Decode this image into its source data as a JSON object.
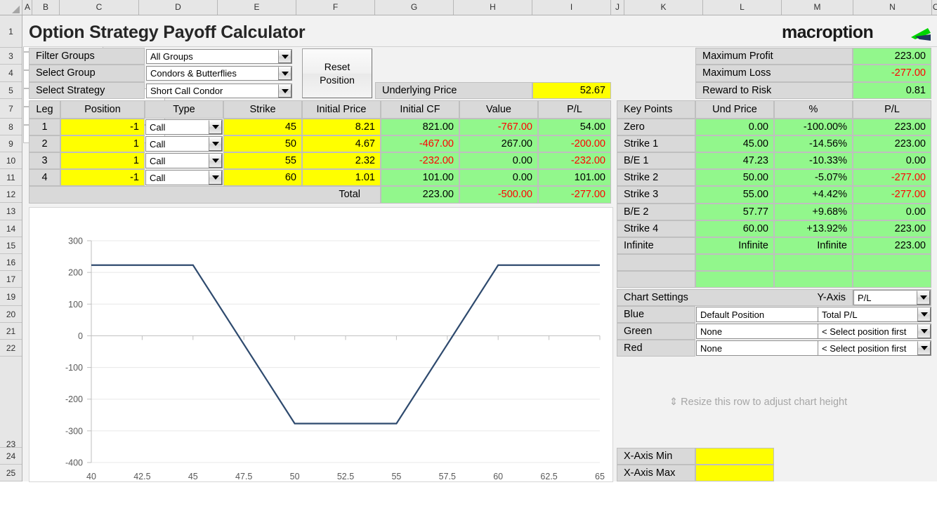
{
  "app": {
    "title": "Option Strategy Payoff Calculator",
    "logo": "macroption"
  },
  "columns": [
    "A",
    "B",
    "C",
    "D",
    "E",
    "F",
    "G",
    "H",
    "I",
    "J",
    "K",
    "L",
    "M",
    "N",
    "O"
  ],
  "rows": [
    "1",
    "3",
    "4",
    "5",
    "7",
    "8",
    "9",
    "10",
    "11",
    "12",
    "13",
    "14",
    "15",
    "16",
    "17",
    "19",
    "20",
    "21",
    "22",
    "23",
    "24",
    "25"
  ],
  "selectors": {
    "filter_groups_label": "Filter Groups",
    "filter_groups_value": "All Groups",
    "select_group_label": "Select Group",
    "select_group_value": "Condors & Butterflies",
    "select_strategy_label": "Select Strategy",
    "select_strategy_value": "Short Call Condor",
    "reset_button": "Reset Position"
  },
  "underlying": {
    "label": "Underlying Price",
    "value": "52.67"
  },
  "summary": {
    "rows": [
      {
        "label": "Maximum Profit",
        "value": "223.00",
        "negative": false
      },
      {
        "label": "Maximum Loss",
        "value": "-277.00",
        "negative": true
      },
      {
        "label": "Reward to Risk",
        "value": "0.81",
        "negative": false
      }
    ]
  },
  "legs": {
    "headers": [
      "Leg",
      "Position",
      "Type",
      "Strike",
      "Initial Price",
      "Initial CF",
      "Value",
      "P/L"
    ],
    "rows": [
      {
        "leg": "1",
        "position": "-1",
        "type": "Call",
        "strike": "45",
        "initial_price": "8.21",
        "initial_cf": "821.00",
        "cf_neg": false,
        "value": "-767.00",
        "value_neg": true,
        "pl": "54.00",
        "pl_neg": false
      },
      {
        "leg": "2",
        "position": "1",
        "type": "Call",
        "strike": "50",
        "initial_price": "4.67",
        "initial_cf": "-467.00",
        "cf_neg": true,
        "value": "267.00",
        "value_neg": false,
        "pl": "-200.00",
        "pl_neg": true
      },
      {
        "leg": "3",
        "position": "1",
        "type": "Call",
        "strike": "55",
        "initial_price": "2.32",
        "initial_cf": "-232.00",
        "cf_neg": true,
        "value": "0.00",
        "value_neg": false,
        "pl": "-232.00",
        "pl_neg": true
      },
      {
        "leg": "4",
        "position": "-1",
        "type": "Call",
        "strike": "60",
        "initial_price": "1.01",
        "initial_cf": "101.00",
        "cf_neg": false,
        "value": "0.00",
        "value_neg": false,
        "pl": "101.00",
        "pl_neg": false
      }
    ],
    "total": {
      "label": "Total",
      "initial_cf": "223.00",
      "cf_neg": false,
      "value": "-500.00",
      "value_neg": true,
      "pl": "-277.00",
      "pl_neg": true
    }
  },
  "key_points": {
    "headers": [
      "Key Points",
      "Und Price",
      "%",
      "P/L"
    ],
    "rows": [
      {
        "name": "Zero",
        "und": "0.00",
        "pct": "-100.00%",
        "pl": "223.00",
        "pl_neg": false
      },
      {
        "name": "Strike 1",
        "und": "45.00",
        "pct": "-14.56%",
        "pl": "223.00",
        "pl_neg": false
      },
      {
        "name": "B/E 1",
        "und": "47.23",
        "pct": "-10.33%",
        "pl": "0.00",
        "pl_neg": false
      },
      {
        "name": "Strike 2",
        "und": "50.00",
        "pct": "-5.07%",
        "pl": "-277.00",
        "pl_neg": true
      },
      {
        "name": "Strike 3",
        "und": "55.00",
        "pct": "+4.42%",
        "pl": "-277.00",
        "pl_neg": true
      },
      {
        "name": "B/E 2",
        "und": "57.77",
        "pct": "+9.68%",
        "pl": "0.00",
        "pl_neg": false
      },
      {
        "name": "Strike 4",
        "und": "60.00",
        "pct": "+13.92%",
        "pl": "223.00",
        "pl_neg": false
      },
      {
        "name": "Infinite",
        "und": "Infinite",
        "pct": "Infinite",
        "pl": "223.00",
        "pl_neg": false
      },
      {
        "name": "",
        "und": "",
        "pct": "",
        "pl": "",
        "pl_neg": false
      },
      {
        "name": "",
        "und": "",
        "pct": "",
        "pl": "",
        "pl_neg": false
      }
    ]
  },
  "chart_settings": {
    "title": "Chart Settings",
    "y_axis_label": "Y-Axis",
    "y_axis_value": "P/L",
    "rows": [
      {
        "color_label": "Blue",
        "position_value": "Default Position",
        "series_value": "Total P/L"
      },
      {
        "color_label": "Green",
        "position_value": "None",
        "series_value": "< Select position first"
      },
      {
        "color_label": "Red",
        "position_value": "None",
        "series_value": "< Select position first"
      }
    ]
  },
  "resize_hint": "⇕ Resize this row to adjust chart height",
  "axis_inputs": {
    "x_min_label": "X-Axis Min",
    "x_min_value": "",
    "x_max_label": "X-Axis Max",
    "x_max_value": ""
  },
  "chart_data": {
    "type": "line",
    "title": "",
    "xlabel": "",
    "ylabel": "",
    "xlim": [
      40,
      65
    ],
    "ylim": [
      -400,
      300
    ],
    "xticks": [
      "40",
      "42.5",
      "45",
      "47.5",
      "50",
      "52.5",
      "55",
      "57.5",
      "60",
      "62.5",
      "65"
    ],
    "yticks": [
      "300",
      "200",
      "100",
      "0",
      "-100",
      "-200",
      "-300",
      "-400"
    ],
    "grid": true,
    "legend": false,
    "series": [
      {
        "name": "Total P/L",
        "color": "#2e4a6e",
        "x": [
          40,
          45,
          50,
          55,
          60,
          65
        ],
        "y": [
          223,
          223,
          -277,
          -277,
          223,
          223
        ]
      }
    ]
  }
}
